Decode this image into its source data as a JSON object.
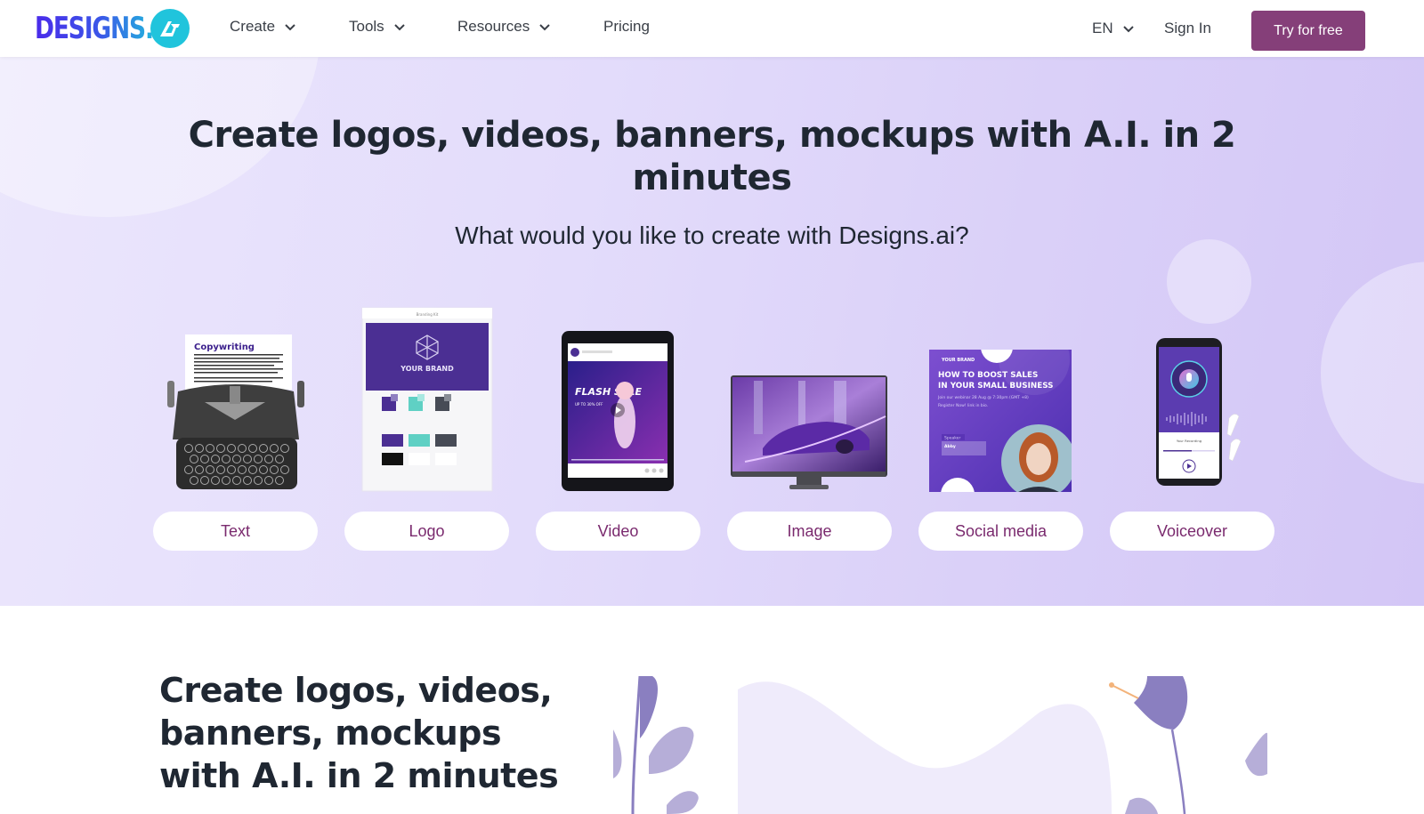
{
  "nav": {
    "logo_text": "DESIGNS.",
    "logo_mark": "AI",
    "items": [
      {
        "label": "Create",
        "has_dropdown": true
      },
      {
        "label": "Tools",
        "has_dropdown": true
      },
      {
        "label": "Resources",
        "has_dropdown": true
      },
      {
        "label": "Pricing",
        "has_dropdown": false
      }
    ],
    "language": "EN",
    "sign_in": "Sign In",
    "cta": "Try for free"
  },
  "colors": {
    "cta_bg": "#853f79",
    "pill_text": "#7a2a6e",
    "heading": "#1f2732",
    "logo_teal": "#20c4dc",
    "logo_blue": "#4a2bea",
    "brand_purple": "#4b2f93"
  },
  "hero": {
    "title": "Create logos, videos, banners, mockups with A.I. in 2 minutes",
    "subtitle": "What would you like to create with Designs.ai?",
    "cards": [
      {
        "label": "Text",
        "art": "typewriter",
        "art_text": "Copywriting"
      },
      {
        "label": "Logo",
        "art": "branding-kit",
        "art_header": "Branding Kit",
        "art_text": "YOUR BRAND"
      },
      {
        "label": "Video",
        "art": "tablet-flash-sale",
        "art_text": "FLASH SALE",
        "art_sub": "UP TO 30% OFF"
      },
      {
        "label": "Image",
        "art": "monitor-car"
      },
      {
        "label": "Social media",
        "art": "social-post",
        "art_brand": "YOUR BRAND",
        "art_text": "HOW TO BOOST SALES IN YOUR SMALL BUSINESS",
        "art_sub": "Join our webinar 28 Aug @ 7:30pm (GMT +8) Register Now! link in bio.",
        "art_speaker_tag": "Speaker",
        "art_speaker": "Abby"
      },
      {
        "label": "Voiceover",
        "art": "phone-recording",
        "art_text": "Your Recording"
      }
    ]
  },
  "section2": {
    "title": "Create logos, videos, banners, mockups with A.I. in 2 minutes"
  }
}
